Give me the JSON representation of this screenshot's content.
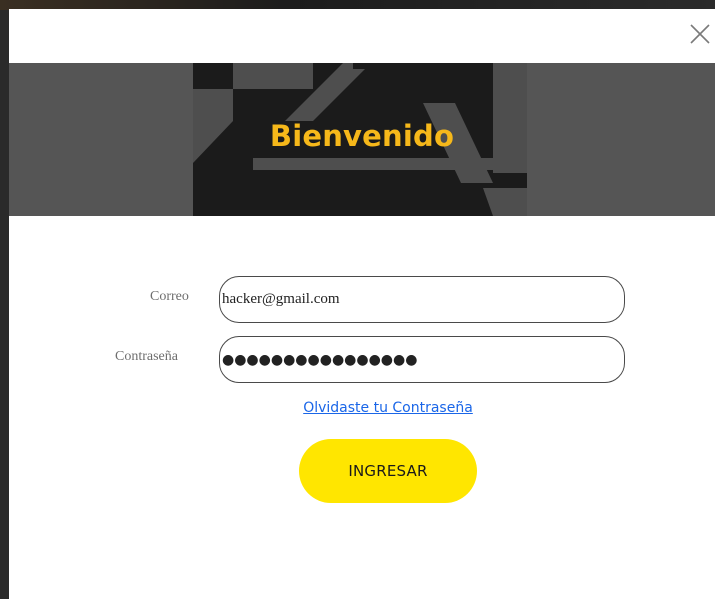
{
  "modal": {
    "banner_title": "Bienvenido",
    "close_icon": "close-icon"
  },
  "form": {
    "email_label": "Correo",
    "email_value": "hacker@gmail.com",
    "password_label": "Contraseña",
    "password_value": "●●●●●●●●●●●●●●●●",
    "forgot_link": "Olvidaste tu Contraseña",
    "submit_label": "INGRESAR"
  },
  "colors": {
    "banner_bg": "#555555",
    "title_color": "#f6b81a",
    "button_bg": "#ffe600",
    "link_color": "#1a66e8"
  }
}
